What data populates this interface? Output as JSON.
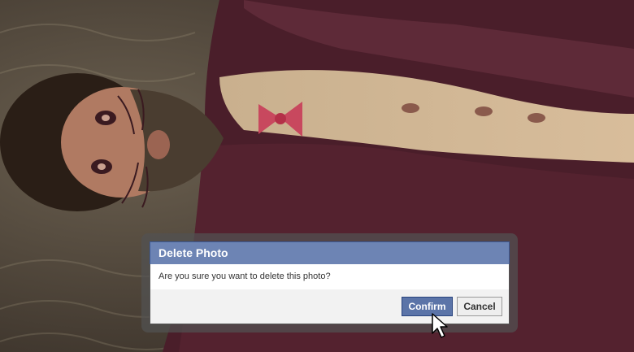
{
  "dialog": {
    "title": "Delete Photo",
    "message": "Are you sure you want to delete this photo?",
    "confirm_label": "Confirm",
    "cancel_label": "Cancel"
  },
  "colors": {
    "header_bg": "#6d84b4",
    "header_border": "#3b5998",
    "confirm_bg": "#5b74a8",
    "cancel_bg": "#eeeeee",
    "footer_bg": "#f2f2f2"
  },
  "icons": {
    "cursor": "arrow-pointer-icon"
  }
}
